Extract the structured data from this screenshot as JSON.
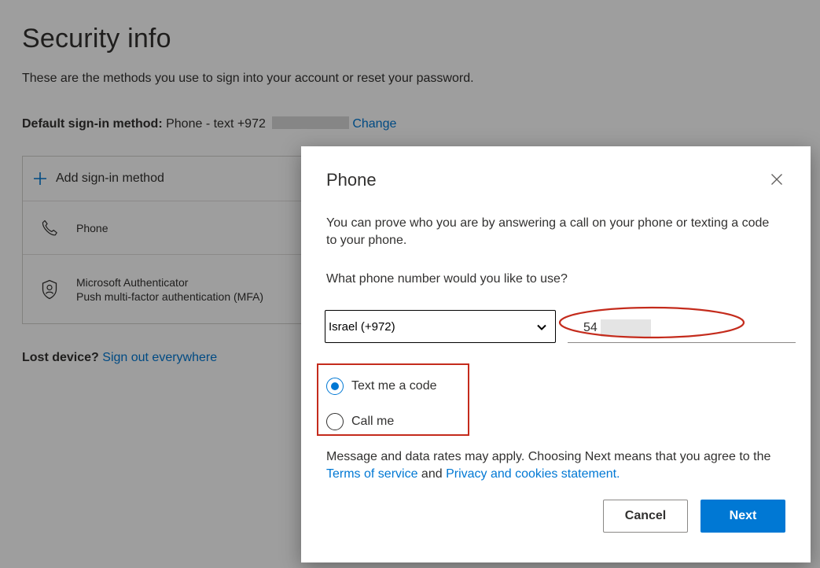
{
  "page": {
    "title": "Security info",
    "description": "These are the methods you use to sign into your account or reset your password.",
    "default_method": {
      "label": "Default sign-in method:",
      "value": "Phone - text +972",
      "change_link": "Change"
    },
    "add_method_label": "Add sign-in method",
    "methods": [
      {
        "icon": "phone-icon",
        "lines": [
          "Phone"
        ]
      },
      {
        "icon": "authenticator-icon",
        "lines": [
          "Microsoft Authenticator",
          "Push multi-factor authentication (MFA)"
        ]
      }
    ],
    "lost_device": {
      "label": "Lost device?",
      "link": "Sign out everywhere"
    }
  },
  "dialog": {
    "title": "Phone",
    "intro": "You can prove who you are by answering a call on your phone or texting a code to your phone.",
    "question": "What phone number would you like to use?",
    "country_value": "Israel (+972)",
    "phone_value": "54",
    "options": [
      {
        "label": "Text me a code",
        "checked": true
      },
      {
        "label": "Call me",
        "checked": false
      }
    ],
    "terms": {
      "prefix": "Message and data rates may apply. Choosing Next means that you agree to the ",
      "tos_link": "Terms of service",
      "middle": " and ",
      "privacy_link": "Privacy and cookies statement."
    },
    "cancel_label": "Cancel",
    "next_label": "Next"
  },
  "colors": {
    "accent": "#0078d4",
    "annotation": "#c42b1c",
    "overlay": "rgba(0,0,0,0.38)"
  }
}
